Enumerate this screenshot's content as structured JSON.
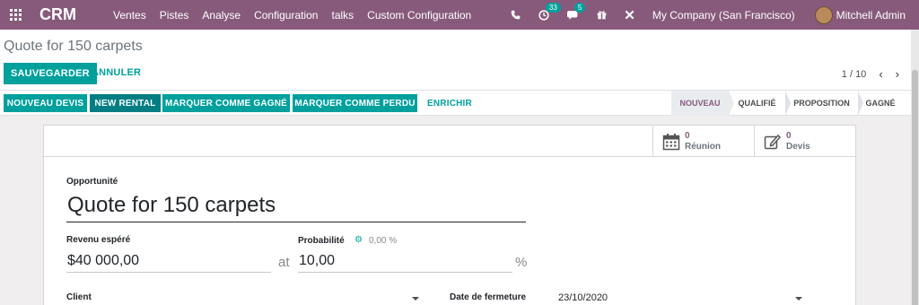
{
  "navbar": {
    "brand": "CRM",
    "menu": [
      "Ventes",
      "Pistes",
      "Analyse",
      "Configuration",
      "talks",
      "Custom Configuration"
    ],
    "activity_count": "33",
    "message_count": "5",
    "company": "My Company (San Francisco)",
    "user": "Mitchell Admin",
    "accent": "#875a7b"
  },
  "control_panel": {
    "breadcrumb": "Quote for 150 carpets",
    "save_label": "SAUVEGARDER",
    "discard_label": "ANNULER",
    "pager_value": "1 / 10"
  },
  "statusbar": {
    "buttons": [
      "NOUVEAU DEVIS",
      "NEW RENTAL",
      "MARQUER COMME GAGNÉ",
      "MARQUER COMME PERDU"
    ],
    "enrich_label": "ENRICHIR",
    "stages": [
      "NOUVEAU",
      "QUALIFIÉ",
      "PROPOSITION",
      "GAGNÉ"
    ],
    "active_stage": "NOUVEAU",
    "primary_color": "#00a09d"
  },
  "form": {
    "stat_meetings_value": "0",
    "stat_meetings_label": "Réunion",
    "stat_quotes_value": "0",
    "stat_quotes_label": "Devis",
    "opportunity_label": "Opportunité",
    "opportunity_name": "Quote for 150 carpets",
    "revenue_label": "Revenu espéré",
    "revenue_value": "$40 000,00",
    "revenue_suffix": "at",
    "probability_label": "Probabilité",
    "probability_auto": "0,00 %",
    "probability_value": "10,00",
    "probability_suffix": "%",
    "client_label": "Client",
    "closing_date_label": "Date de fermeture",
    "closing_date_value": "23/10/2020"
  }
}
